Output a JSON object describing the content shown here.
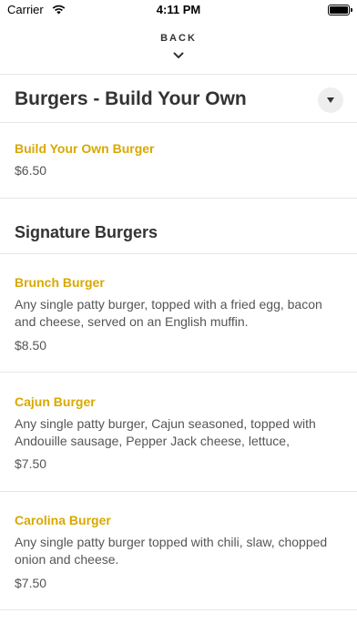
{
  "status_bar": {
    "carrier": "Carrier",
    "time": "4:11 PM"
  },
  "nav": {
    "back_label": "BACK"
  },
  "section": {
    "title": "Burgers - Build Your Own"
  },
  "items_top": [
    {
      "name": "Build Your Own Burger",
      "price": "$6.50"
    }
  ],
  "subsection": {
    "title": "Signature Burgers"
  },
  "items": [
    {
      "name": "Brunch Burger",
      "description": "Any single patty burger, topped with a fried egg, bacon and cheese, served on an English muffin.",
      "price": "$8.50"
    },
    {
      "name": "Cajun Burger",
      "description": "Any single patty burger, Cajun seasoned, topped with Andouille sausage, Pepper Jack cheese, lettuce, tomato...",
      "price": "$7.50"
    },
    {
      "name": "Carolina Burger",
      "description": "Any single patty burger topped with chili, slaw, chopped onion and cheese.",
      "price": "$7.50"
    }
  ],
  "colors": {
    "accent": "#d9a800",
    "text": "#333333",
    "divider": "#e6e6e6"
  }
}
